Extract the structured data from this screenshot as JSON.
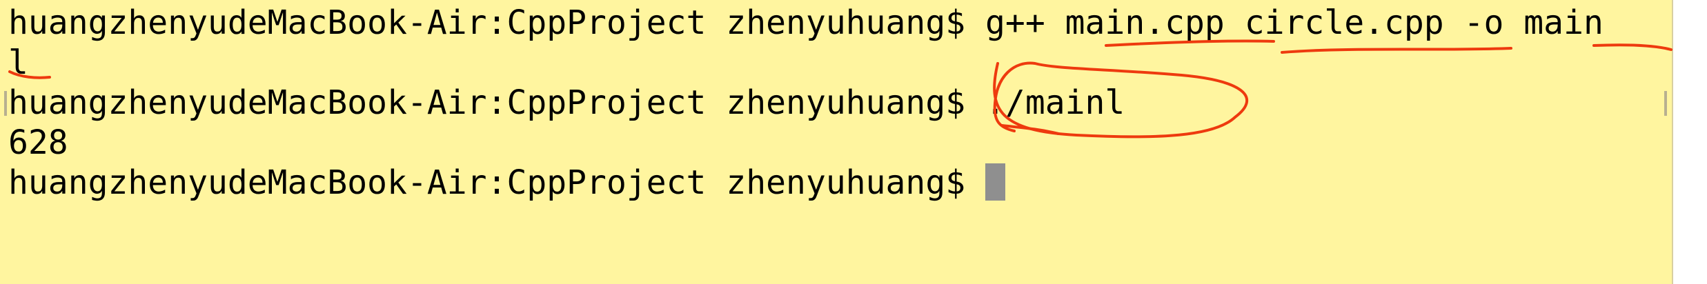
{
  "terminal": {
    "lines": [
      "huangzhenyudeMacBook-Air:CppProject zhenyuhuang$ g++ main.cpp circle.cpp -o main",
      "l",
      "huangzhenyudeMacBook-Air:CppProject zhenyuhuang$ ./mainl",
      "628",
      "huangzhenyudeMacBook-Air:CppProject zhenyuhuang$ "
    ],
    "cursor_color": "#8f8f8f",
    "background_color": "#fff59f"
  },
  "annotations": {
    "ink_color": "#ee3a0e"
  }
}
